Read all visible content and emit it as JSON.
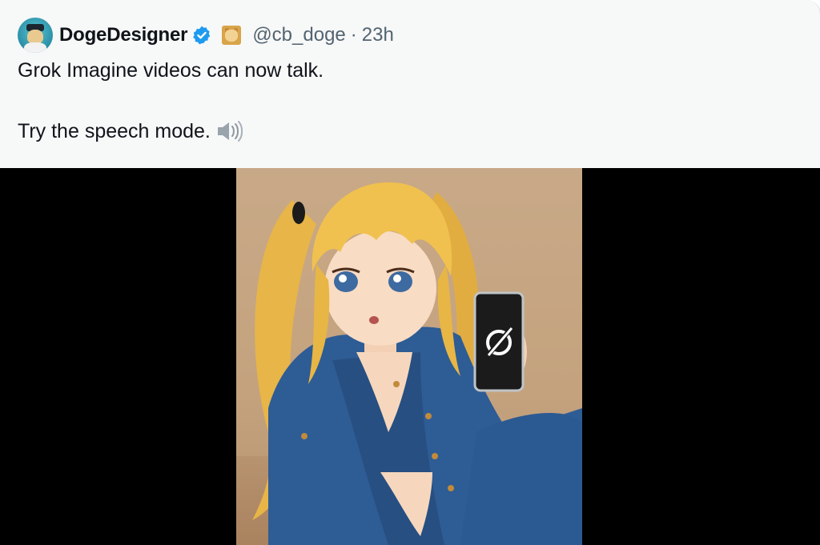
{
  "tweet": {
    "author": {
      "display_name": "DogeDesigner",
      "handle": "@cb_doge",
      "separator": "·",
      "timestamp": "23h",
      "verified": true
    },
    "text": {
      "line1": "Grok Imagine videos can now talk.",
      "line2": "Try the speech mode."
    },
    "media": {
      "type": "video",
      "subject": "anime-girl-holding-phone",
      "phone_logo": "grok-logo-icon"
    }
  },
  "colors": {
    "text_primary": "#0f1419",
    "text_secondary": "#536471",
    "verified_blue": "#1d9bf0",
    "card_bg": "#f7f8f8",
    "media_bg": "#000000"
  },
  "icons": [
    "avatar",
    "verified-badge-icon",
    "doge-badge-icon",
    "speaker-icon",
    "grok-logo-icon"
  ]
}
